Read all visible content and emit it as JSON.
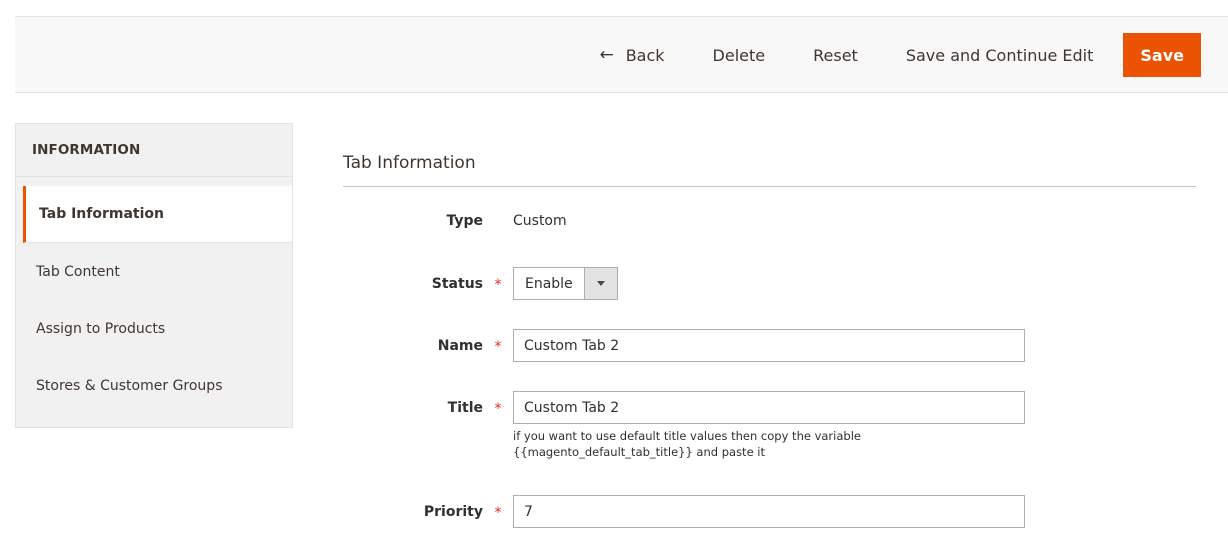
{
  "toolbar": {
    "back_label": "Back",
    "back_icon": "arrow-left-icon",
    "delete_label": "Delete",
    "reset_label": "Reset",
    "save_continue_label": "Save and Continue Edit",
    "save_label": "Save"
  },
  "sidebar": {
    "title": "INFORMATION",
    "items": [
      {
        "label": "Tab Information",
        "active": true
      },
      {
        "label": "Tab Content",
        "active": false
      },
      {
        "label": "Assign to Products",
        "active": false
      },
      {
        "label": "Stores & Customer Groups",
        "active": false
      }
    ]
  },
  "section": {
    "title": "Tab Information"
  },
  "form": {
    "type": {
      "label": "Type",
      "value": "Custom"
    },
    "status": {
      "label": "Status",
      "value": "Enable",
      "required": true
    },
    "name": {
      "label": "Name",
      "value": "Custom Tab 2",
      "required": true
    },
    "title": {
      "label": "Title",
      "value": "Custom Tab 2",
      "required": true,
      "note": "if you want to use default title values then copy the variable {{magento_default_tab_title}} and paste it"
    },
    "priority": {
      "label": "Priority",
      "value": "7",
      "required": true
    },
    "required_marker": "*"
  },
  "colors": {
    "accent": "#eb5202",
    "required": "#e22626"
  }
}
